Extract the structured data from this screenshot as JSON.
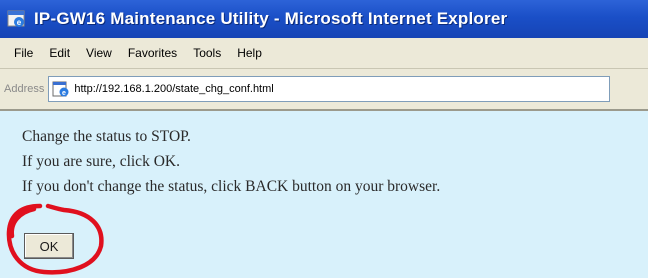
{
  "window": {
    "title": "IP-GW16 Maintenance Utility - Microsoft Internet Explorer",
    "icon": "ie-app-icon"
  },
  "menu": {
    "items": [
      "File",
      "Edit",
      "View",
      "Favorites",
      "Tools",
      "Help"
    ]
  },
  "address": {
    "label": "Address",
    "url": "http://192.168.1.200/state_chg_conf.html",
    "icon": "page-icon"
  },
  "content": {
    "line1": "Change the status to STOP.",
    "line2": "If you are sure, click OK.",
    "line3": "If you don't change the status, click BACK button on your browser.",
    "ok_label": "OK"
  },
  "colors": {
    "titlebar": "#1a4fc7",
    "content_bg": "#d8f1fb",
    "annotation": "#e0101e"
  }
}
